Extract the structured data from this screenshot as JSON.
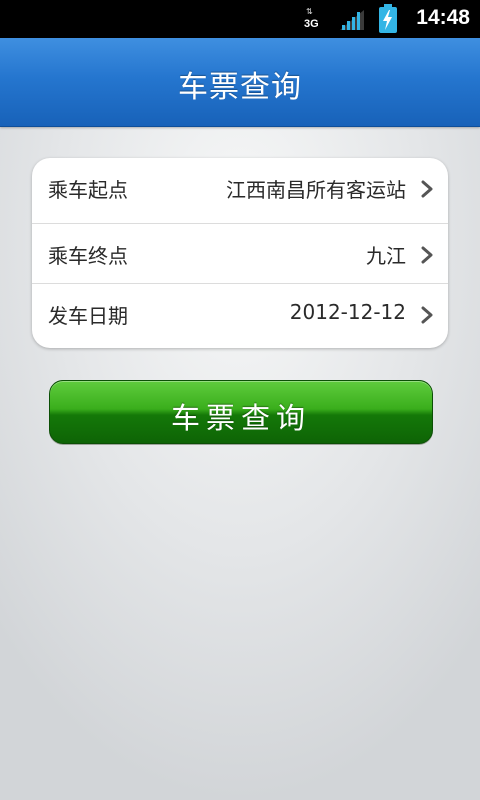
{
  "status_bar": {
    "network_label": "3G",
    "time": "14:48",
    "icons": [
      "data-arrows-icon",
      "signal-icon",
      "battery-charging-icon"
    ]
  },
  "header": {
    "title": "车票查询"
  },
  "form": {
    "rows": [
      {
        "label": "乘车起点",
        "value": "江西南昌所有客运站"
      },
      {
        "label": "乘车终点",
        "value": "九江"
      },
      {
        "label": "发车日期",
        "value": "2012-12-12"
      }
    ]
  },
  "query_button": {
    "label": "车票查询"
  },
  "colors": {
    "title_bar": "#2576cf",
    "button_green": "#2a9a14",
    "battery_accent": "#33b5e5"
  }
}
